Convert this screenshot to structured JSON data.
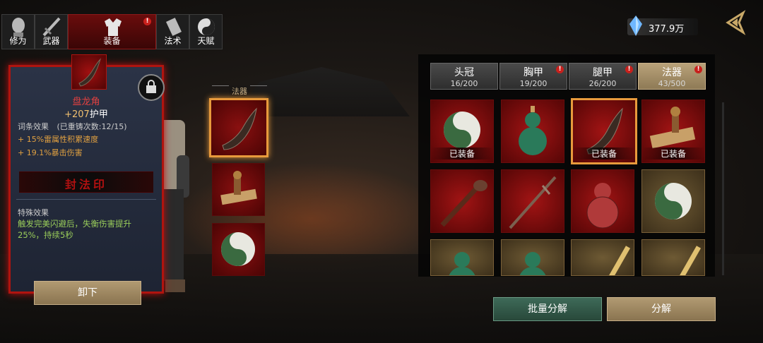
{
  "top_tabs": [
    {
      "label": "修为",
      "icon": "head-icon"
    },
    {
      "label": "武器",
      "icon": "sword-icon"
    },
    {
      "label": "装备",
      "icon": "robe-icon",
      "badge": "!"
    },
    {
      "label": "法术",
      "icon": "scroll-icon"
    },
    {
      "label": "天赋",
      "icon": "yinyang-icon"
    }
  ],
  "currency": {
    "amount": "377.9万",
    "icon": "crystal-icon"
  },
  "back_icon": "back-arrow-icon",
  "detail": {
    "item_name": "盘龙角",
    "armor_value": "+207",
    "armor_label": "护甲",
    "affix_title": "词条效果",
    "affix_count": "(已重铸次数:12/15)",
    "affixes": [
      "+ 15%雷属性积累速度",
      "+ 19.1%暴击伤害"
    ],
    "seal_text": "封法印",
    "special_title": "特殊效果",
    "special_desc": "触发完美闪避后，失衡伤害提升25%，持续5秒",
    "unequip_label": "卸下"
  },
  "slot_title": "法器",
  "slots": [
    "horn",
    "stamp",
    "yinyang"
  ],
  "categories": [
    {
      "name": "头冠",
      "count": "16/200",
      "badge": ""
    },
    {
      "name": "胸甲",
      "count": "19/200",
      "badge": "!"
    },
    {
      "name": "腿甲",
      "count": "26/200",
      "badge": "!"
    },
    {
      "name": "法器",
      "count": "43/500",
      "badge": "!"
    }
  ],
  "equipped_tag": "已装备",
  "grid_items": [
    {
      "item": "yinyang",
      "equipped": true
    },
    {
      "item": "gourd-green",
      "equipped": false
    },
    {
      "item": "horn",
      "equipped": true
    },
    {
      "item": "stamp",
      "equipped": true
    },
    {
      "item": "ruyi",
      "equipped": false
    },
    {
      "item": "staff-sword",
      "equipped": false
    },
    {
      "item": "gourd-red",
      "equipped": false
    },
    {
      "item": "yinyang",
      "equipped": false
    },
    {
      "item": "gourd-green",
      "equipped": false
    },
    {
      "item": "gourd-green",
      "equipped": false
    },
    {
      "item": "talisman-stick",
      "equipped": false
    },
    {
      "item": "talisman-stick",
      "equipped": false
    }
  ],
  "batch_decompose_label": "批量分解",
  "decompose_label": "分解"
}
